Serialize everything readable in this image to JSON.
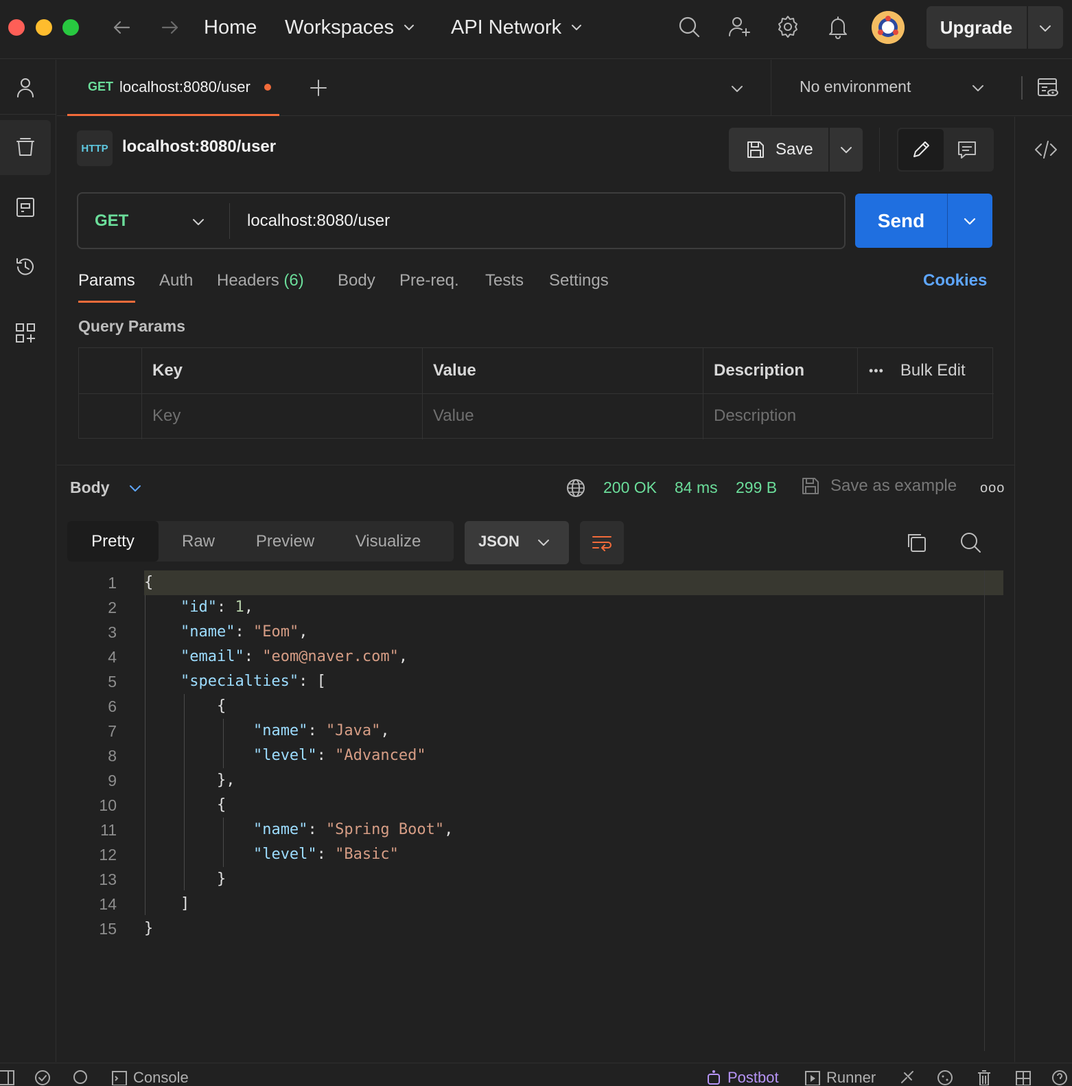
{
  "nav": {
    "home": "Home",
    "workspaces": "Workspaces",
    "api_network": "API Network",
    "upgrade": "Upgrade"
  },
  "tab": {
    "method": "GET",
    "title": "localhost:8080/user"
  },
  "environment": "No environment",
  "request": {
    "name": "localhost:8080/user",
    "save_label": "Save",
    "method": "GET",
    "url": "localhost:8080/user",
    "send_label": "Send",
    "http_badge": "HTTP"
  },
  "request_tabs": {
    "params": "Params",
    "auth": "Auth",
    "headers": "Headers",
    "headers_count": "(6)",
    "body": "Body",
    "prereq": "Pre-req.",
    "tests": "Tests",
    "settings": "Settings",
    "cookies": "Cookies"
  },
  "query_params": {
    "title": "Query Params",
    "headers": {
      "key": "Key",
      "value": "Value",
      "description": "Description",
      "bulk_edit": "Bulk Edit",
      "more": "•••"
    },
    "placeholders": {
      "key": "Key",
      "value": "Value",
      "description": "Description"
    }
  },
  "response": {
    "section_label": "Body",
    "status": "200 OK",
    "time": "84 ms",
    "size": "299 B",
    "save_example": "Save as example",
    "more": "ooo",
    "view_tabs": [
      "Pretty",
      "Raw",
      "Preview",
      "Visualize"
    ],
    "active_view": "Pretty",
    "format": "JSON",
    "lines": [
      "1",
      "2",
      "3",
      "4",
      "5",
      "6",
      "7",
      "8",
      "9",
      "10",
      "11",
      "12",
      "13",
      "14",
      "15"
    ]
  },
  "statusbar": {
    "console": "Console",
    "postbot": "Postbot",
    "runner": "Runner"
  },
  "colors": {
    "accent": "#f26b3a",
    "send": "#1f6fe0",
    "get_method": "#6bdd9a",
    "link": "#5ea6ff",
    "json_key": "#9cdcfe",
    "json_string": "#d69d85",
    "json_number": "#b5cea8",
    "postbot": "#b694f5"
  }
}
